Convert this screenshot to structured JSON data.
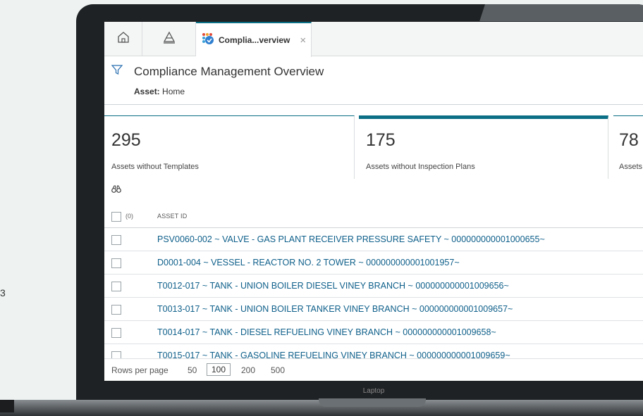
{
  "tabs": {
    "home_icon": "home-icon",
    "hierarchy_icon": "pyramid-icon",
    "active_label": "Complia...verview",
    "close_glyph": "×"
  },
  "header": {
    "title": "Compliance Management Overview",
    "asset_label": "Asset:",
    "asset_value": "Home"
  },
  "cards": [
    {
      "count": "295",
      "caption": "Assets without Templates"
    },
    {
      "count": "175",
      "caption": "Assets without Inspection Plans"
    },
    {
      "count": "78",
      "caption": "Assets"
    }
  ],
  "table": {
    "selected_count": "(0)",
    "column": "ASSET ID",
    "rows": [
      "PSV0060-002 ~ VALVE - GAS PLANT RECEIVER PRESSURE SAFETY ~ 000000000001000655~",
      "D0001-004 ~ VESSEL - REACTOR NO. 2 TOWER ~ 000000000001001957~",
      "T0012-017 ~ TANK - UNION BOILER DIESEL VINEY BRANCH ~ 000000000001009656~",
      "T0013-017 ~ TANK - UNION BOILER TANKER VINEY BRANCH ~ 000000000001009657~",
      "T0014-017 ~ TANK - DIESEL REFUELING VINEY BRANCH ~ 000000000001009658~",
      "T0015-017 ~ TANK - GASOLINE REFUELING VINEY BRANCH ~ 000000000001009659~"
    ]
  },
  "pager": {
    "label": "Rows per page",
    "options": [
      "50",
      "100",
      "200",
      "500"
    ],
    "selected": "100"
  },
  "laptop_label": "Laptop",
  "edge_text": "3",
  "colors": {
    "accent": "#0b6f85",
    "link": "#0e5f8a"
  }
}
